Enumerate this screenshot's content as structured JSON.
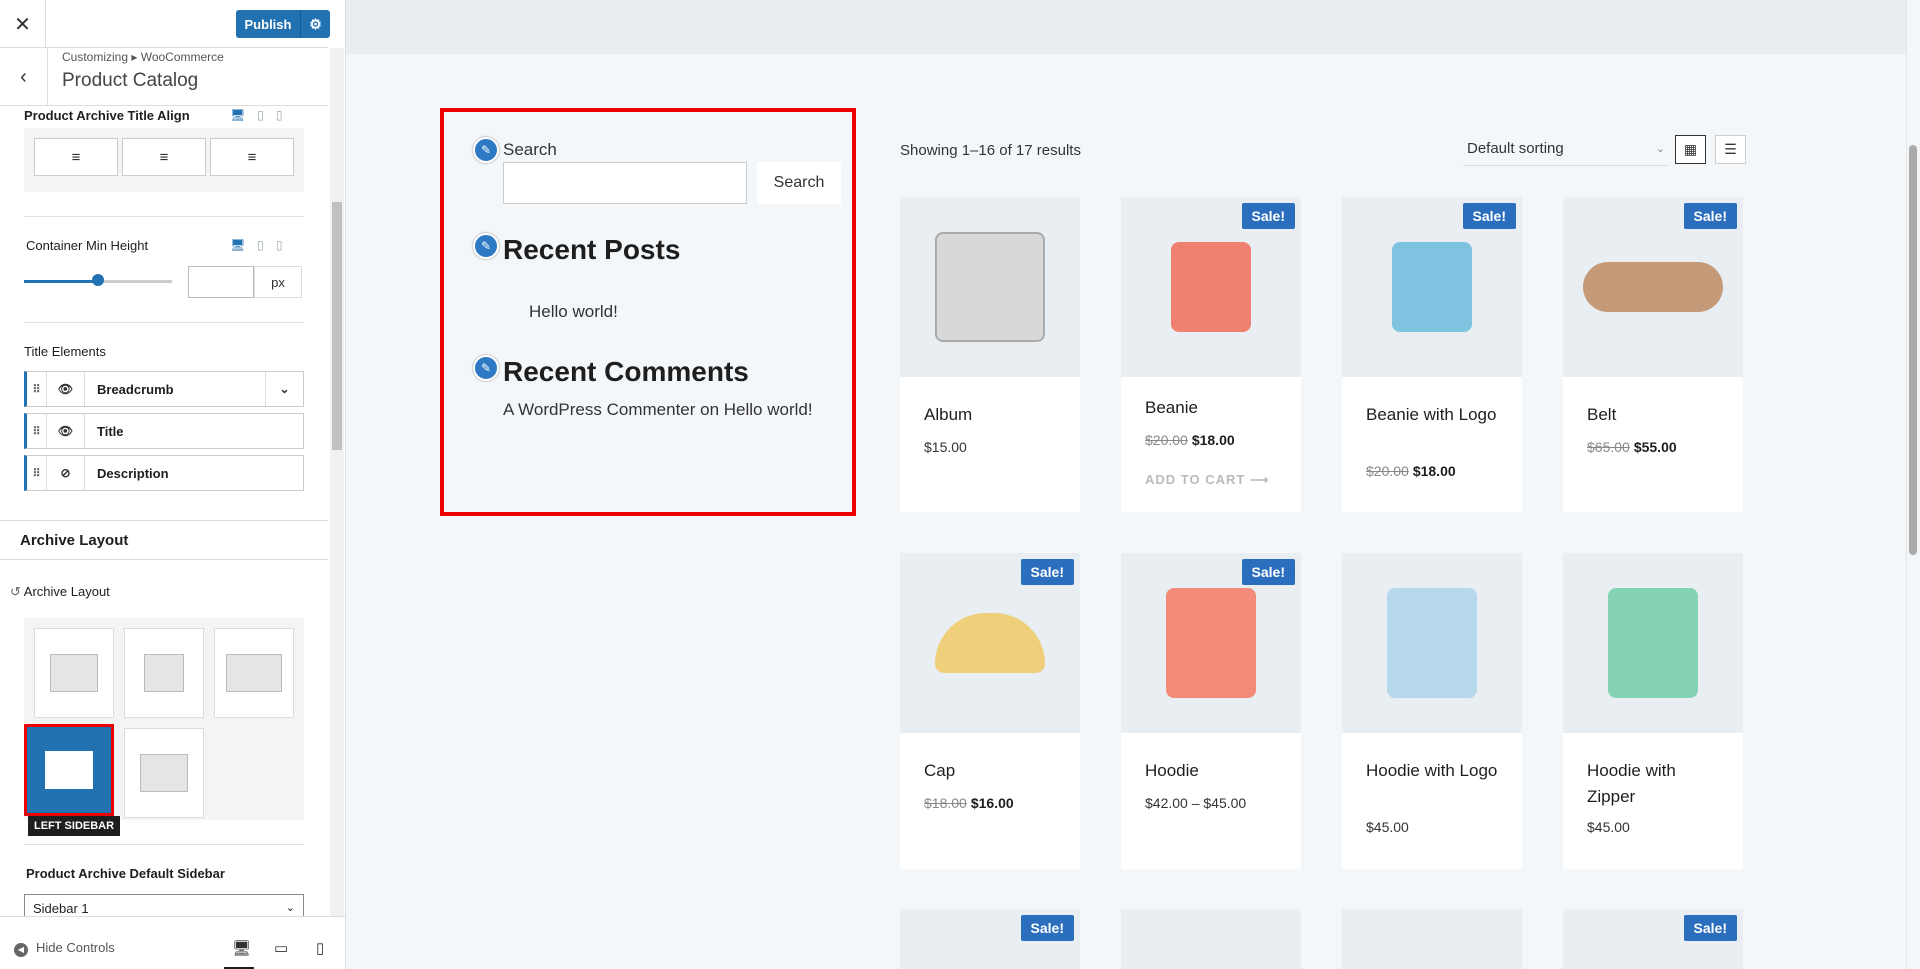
{
  "sidebar": {
    "close_icon": "close-icon",
    "publish_label": "Publish",
    "crumb": "Customizing ▸ WooCommerce",
    "title": "Product Catalog",
    "title_align_label": "Product Archive Title Align",
    "container_min_height_label": "Container Min Height",
    "container_min_height_value": "",
    "unit": "px",
    "title_elements_label": "Title Elements",
    "title_elements": [
      {
        "label": "Breadcrumb",
        "visible": true
      },
      {
        "label": "Title",
        "visible": true
      },
      {
        "label": "Description",
        "visible": false
      }
    ],
    "archive_layout_heading": "Archive Layout",
    "archive_layout_label": "Archive Layout",
    "layout_tooltip": "LEFT SIDEBAR",
    "default_sidebar_label": "Product Archive Default Sidebar",
    "default_sidebar_value": "Sidebar 1",
    "hide_controls": "Hide Controls",
    "accent": "#2271b1"
  },
  "widgets": {
    "search_label": "Search",
    "search_button": "Search",
    "recent_posts_title": "Recent Posts",
    "recent_post_item": "Hello world!",
    "recent_comments_title": "Recent Comments",
    "recent_comment_item": "A WordPress Commenter on Hello world!"
  },
  "shop": {
    "showing": "Showing 1–16 of 17 results",
    "sort": "Default sorting",
    "sale_label": "Sale!",
    "add_to_cart": "ADD TO CART ⟶",
    "products": [
      {
        "name": "Album",
        "price": "$15.00",
        "old_price": "",
        "sale": false
      },
      {
        "name": "Beanie",
        "price": "$18.00",
        "old_price": "$20.00",
        "sale": true
      },
      {
        "name": "Beanie with Logo",
        "price": "$18.00",
        "old_price": "$20.00",
        "sale": true
      },
      {
        "name": "Belt",
        "price": "$55.00",
        "old_price": "$65.00",
        "sale": true
      },
      {
        "name": "Cap",
        "price": "$16.00",
        "old_price": "$18.00",
        "sale": true
      },
      {
        "name": "Hoodie",
        "price": "$42.00 – $45.00",
        "old_price": "",
        "sale": true
      },
      {
        "name": "Hoodie with Logo",
        "price": "$45.00",
        "old_price": "",
        "sale": false
      },
      {
        "name": "Hoodie with Zipper",
        "price": "$45.00",
        "old_price": "",
        "sale": false
      }
    ]
  }
}
